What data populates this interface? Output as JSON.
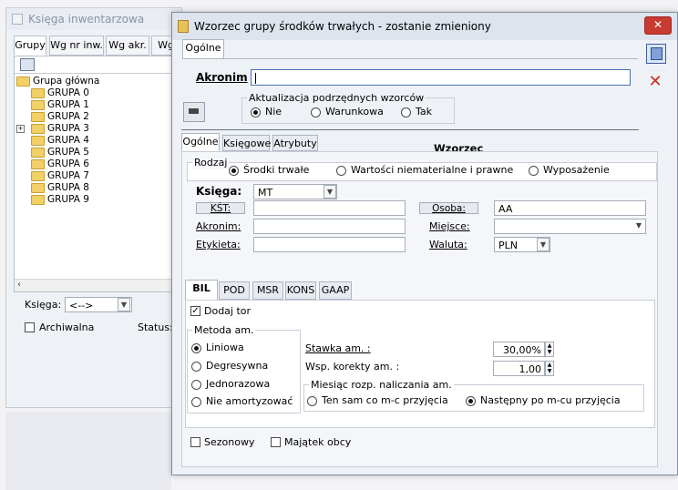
{
  "bg_window": {
    "title": "Księga inwentarzowa",
    "tabs": [
      "Grupy",
      "Wg nr inw.",
      "Wg akr.",
      "Wg"
    ],
    "tree_root": "Grupa główna",
    "tree_items": [
      "GRUPA 0",
      "GRUPA 1",
      "GRUPA 2",
      "GRUPA 3",
      "GRUPA 4",
      "GRUPA 5",
      "GRUPA 6",
      "GRUPA 7",
      "GRUPA 8",
      "GRUPA 9"
    ],
    "ksiega_label": "Księga:",
    "ksiega_value": "<-->",
    "archiwalna_label": "Archiwalna",
    "status_label": "Status:"
  },
  "dialog": {
    "title": "Wzorzec grupy środków trwałych - zostanie zmieniony",
    "top_tab": "Ogólne",
    "akronim_label": "Akronim",
    "akronim_value": "",
    "aktualizacja_label": "Aktualizacja podrzędnych wzorców",
    "aktualizacja_options": [
      "Nie",
      "Warunkowa",
      "Tak"
    ],
    "aktualizacja_selected": 0,
    "sub_tabs": [
      "Ogólne",
      "Księgowe",
      "Atrybuty"
    ],
    "wzorzec_label": "Wzorzec",
    "rodzaj_label": "Rodzaj",
    "rodzaj_options": [
      "Środki trwałe",
      "Wartości niematerialne i prawne",
      "Wyposażenie"
    ],
    "rodzaj_selected": 0,
    "ksiega_label": "Księga:",
    "ksiega_value": "MT",
    "kst_label": "KŚT:",
    "kst_value": "",
    "osoba_label": "Osoba:",
    "osoba_value": "AA",
    "akronim2_label": "Akronim:",
    "akronim2_value": "",
    "miejsce_label": "Miejsce:",
    "miejsce_value": "",
    "etykieta_label": "Etykieta:",
    "etykieta_value": "",
    "waluta_label": "Waluta:",
    "waluta_value": "PLN",
    "book_tabs": [
      "BIL",
      "POD",
      "MSR",
      "KONS",
      "GAAP"
    ],
    "dodaj_tor_label": "Dodaj tor",
    "metoda_label": "Metoda am.",
    "metoda_options": [
      "Liniowa",
      "Degresywna",
      "Jednorazowa",
      "Nie amortyzować"
    ],
    "metoda_selected": 0,
    "stawka_label": "Stawka am. :",
    "stawka_value": "30,00%",
    "wsp_label": "Wsp. korekty am. :",
    "wsp_value": "1,00",
    "miesiac_label": "Miesiąc rozp. naliczania am.",
    "miesiac_options": [
      "Ten sam co m-c przyjęcia",
      "Następny po m-cu przyjęcia"
    ],
    "miesiac_selected": 1,
    "sezonowy_label": "Sezonowy",
    "majatek_label": "Majątek obcy"
  }
}
